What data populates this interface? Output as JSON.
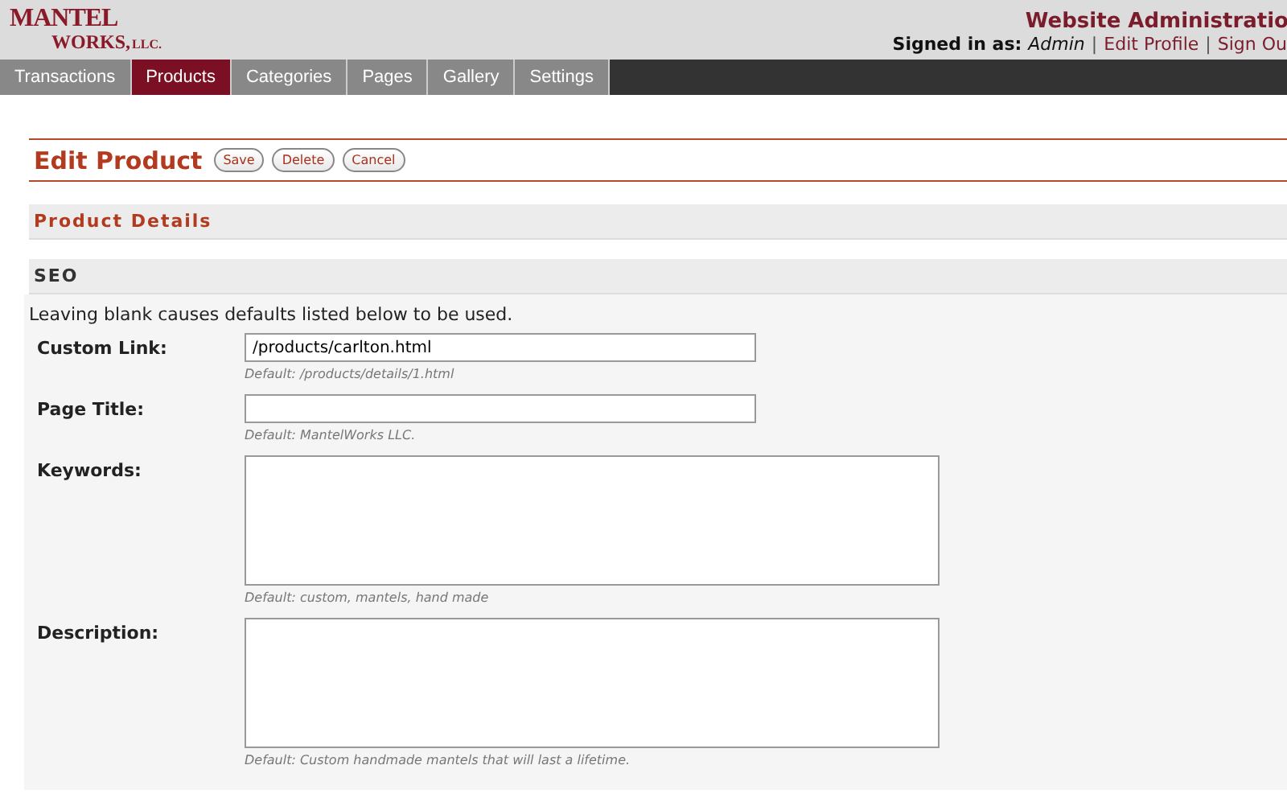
{
  "logo": {
    "line1": "MANTEL",
    "line2": "WORKS,",
    "suffix": "LLC."
  },
  "header": {
    "title": "Website Administratio",
    "signed_in_label": "Signed in as:",
    "user": "Admin",
    "separator_1": "|",
    "edit_profile": "Edit Profile",
    "separator_2": "|",
    "sign_out": "Sign Ou"
  },
  "tabs": [
    {
      "label": "Transactions",
      "selected": false
    },
    {
      "label": "Products",
      "selected": true
    },
    {
      "label": "Categories",
      "selected": false
    },
    {
      "label": "Pages",
      "selected": false
    },
    {
      "label": "Gallery",
      "selected": false
    },
    {
      "label": "Settings",
      "selected": false
    }
  ],
  "page_title": "Edit Product",
  "buttons": [
    "Save",
    "Delete",
    "Cancel"
  ],
  "section": "Product Details",
  "subsection": "SEO",
  "note": "Leaving blank causes defaults listed below to be used.",
  "fields": [
    {
      "kind": "input",
      "label": "Custom Link:",
      "value": "/products/carlton.html",
      "hint": "Default: /products/details/1.html"
    },
    {
      "kind": "input",
      "label": "Page Title:",
      "hint": "Default: MantelWorks LLC."
    },
    {
      "kind": "textarea",
      "label": "Keywords:",
      "hint": "Default: custom, mantels, hand made"
    },
    {
      "kind": "textarea",
      "label": "Description:",
      "hint": "Default: Custom handmade mantels that will last a lifetime."
    }
  ]
}
